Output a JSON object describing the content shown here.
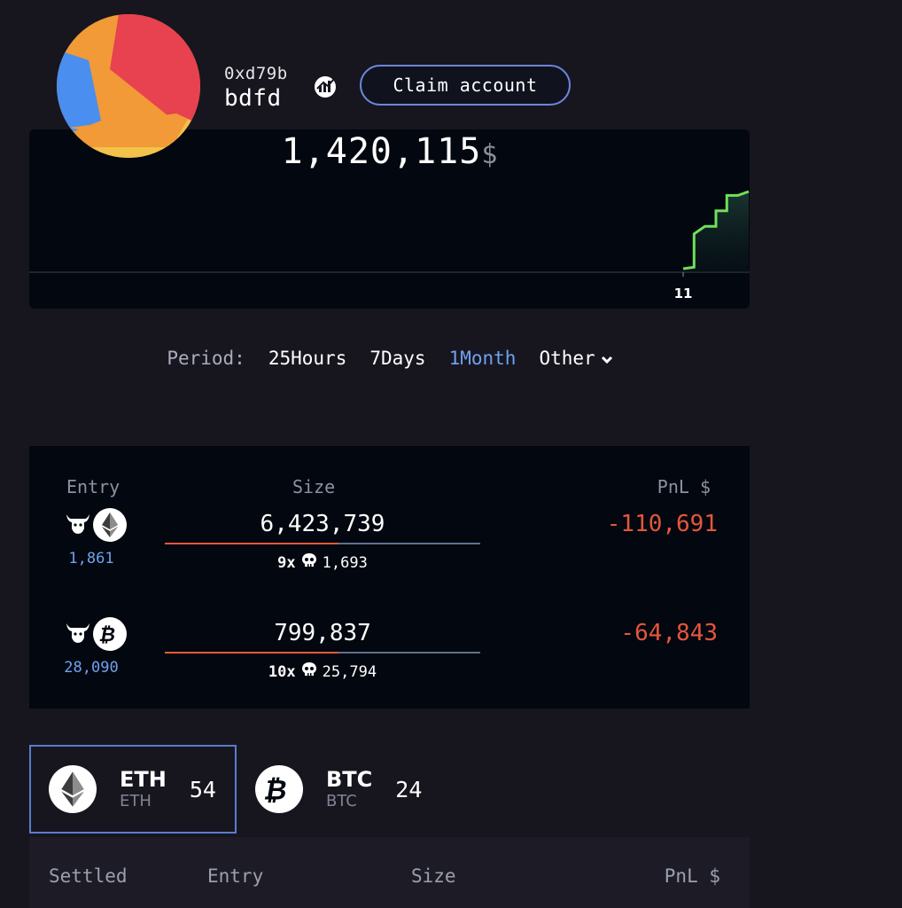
{
  "profile": {
    "address": "0xd79b",
    "username": "bdfd",
    "claim_label": "Claim account",
    "avatar_colors": [
      "#e8414f",
      "#f19a37",
      "#4a8ef0",
      "#f3c24a"
    ]
  },
  "balance": {
    "value": "1,420,115",
    "currency": "$"
  },
  "chart_data": {
    "type": "line",
    "title": "",
    "xlabel": "",
    "ylabel": "",
    "x_ticks": [
      "11"
    ],
    "series": [
      {
        "color": "#6ee05a",
        "points": [
          [
            0,
            0.0
          ],
          [
            1,
            0.02
          ],
          [
            1,
            0.45
          ],
          [
            2,
            0.55
          ],
          [
            3,
            0.55
          ],
          [
            3,
            0.75
          ],
          [
            4,
            0.75
          ],
          [
            4,
            0.95
          ],
          [
            5,
            0.95
          ],
          [
            6,
            1.0
          ]
        ]
      }
    ],
    "grid": false
  },
  "period": {
    "label": "Period:",
    "options": [
      "25Hours",
      "7Days",
      "1Month",
      "Other"
    ],
    "active": "1Month"
  },
  "positions": {
    "headers": {
      "entry": "Entry",
      "size": "Size",
      "pnl": "PnL $"
    },
    "rows": [
      {
        "direction": "bull",
        "coin": "eth-icon",
        "entry_price": "1,861",
        "size": "6,423,739",
        "leverage": "9x",
        "liquidation": "1,693",
        "pnl": "-110,691",
        "bar_fill": 0.55
      },
      {
        "direction": "bull",
        "coin": "btc-icon",
        "entry_price": "28,090",
        "size": "799,837",
        "leverage": "10x",
        "liquidation": "25,794",
        "pnl": "-64,843",
        "bar_fill": 0.55
      }
    ]
  },
  "assets": [
    {
      "symbol": "ETH",
      "sub": "ETH",
      "count": "54",
      "icon": "eth-icon",
      "selected": true
    },
    {
      "symbol": "BTC",
      "sub": "BTC",
      "count": "24",
      "icon": "btc-icon",
      "selected": false
    }
  ],
  "settled": {
    "headers": {
      "settled": "Settled",
      "entry": "Entry",
      "size": "Size",
      "pnl": "PnL $"
    }
  },
  "colors": {
    "accent": "#6ea2ef",
    "loss": "#e4563c",
    "gain_line": "#6ee05a"
  }
}
